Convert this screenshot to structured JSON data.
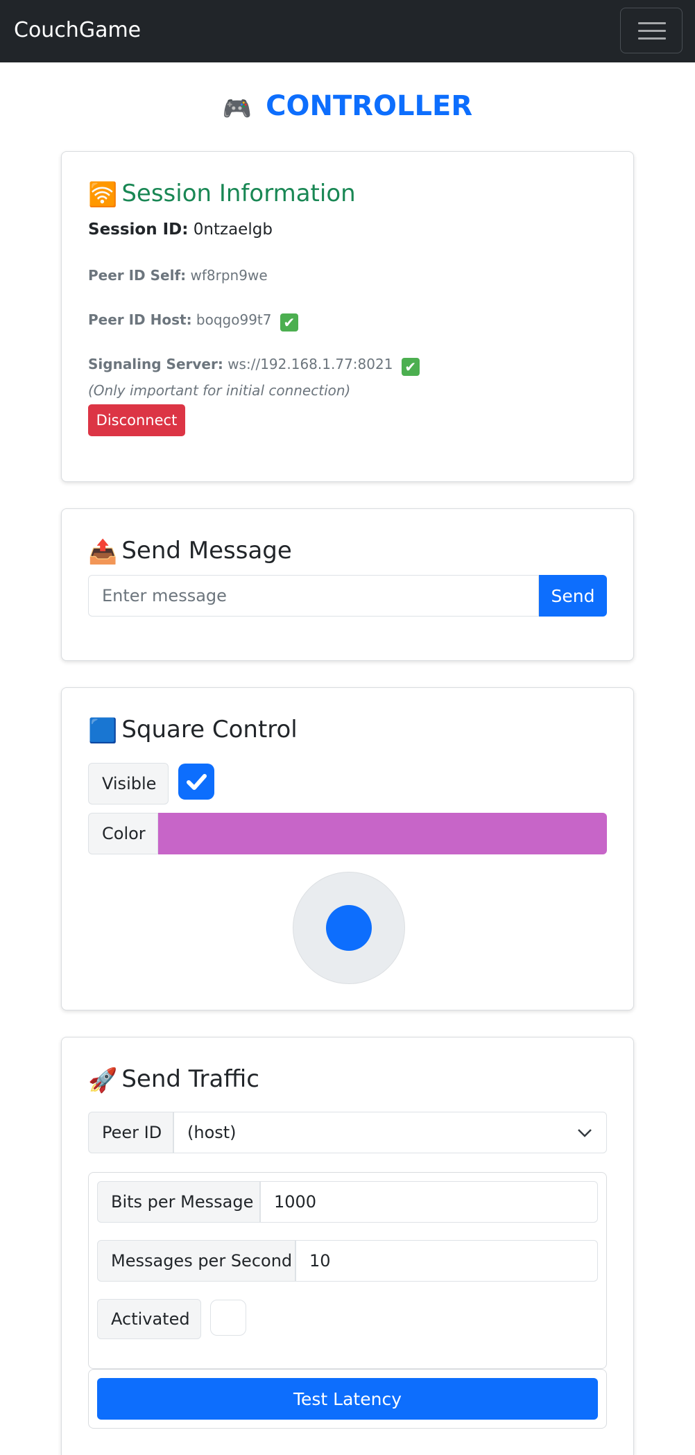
{
  "navbar": {
    "brand": "CouchGame"
  },
  "page": {
    "title": "CONTROLLER",
    "title_icon": "🎮"
  },
  "session": {
    "title": "Session Information",
    "title_icon": "🛜",
    "session_id_label": "Session ID:",
    "session_id": "0ntzaelgb",
    "peer_self_label": "Peer ID Self:",
    "peer_self": "wf8rpn9we",
    "peer_host_label": "Peer ID Host:",
    "peer_host": "boqgo99t7",
    "signaling_label": "Signaling Server:",
    "signaling": "ws://192.168.1.77:8021",
    "note": "(Only important for initial connection)",
    "disconnect_label": "Disconnect",
    "check_glyph": "✔"
  },
  "send_message": {
    "title": "Send Message",
    "title_icon": "📤",
    "placeholder": "Enter message",
    "send_label": "Send"
  },
  "square": {
    "title": "Square Control",
    "title_icon": "🟦",
    "visible_label": "Visible",
    "visible_checked": true,
    "color_label": "Color",
    "color": "#c765c8",
    "check_glyph": "✔"
  },
  "traffic": {
    "title": "Send Traffic",
    "title_icon": "🚀",
    "peer_id_label": "Peer ID",
    "peer_id_value": "(host)",
    "bits_label": "Bits per Message",
    "bits_value": "1000",
    "mps_label": "Messages per Second",
    "mps_value": "10",
    "activated_label": "Activated",
    "activated_checked": false,
    "test_latency_label": "Test Latency"
  },
  "colors": {
    "primary": "#0d6efd",
    "danger": "#dc3545",
    "success_heading": "#198754",
    "navbar": "#212529"
  }
}
